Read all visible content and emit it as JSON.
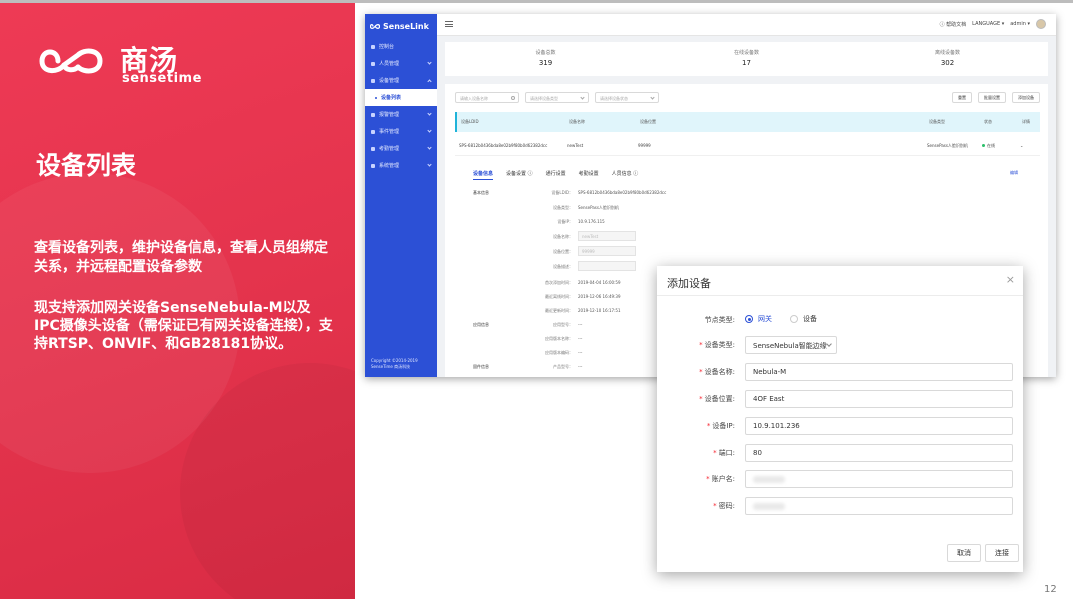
{
  "slide": {
    "logo_cn": "商汤",
    "logo_en": "sensetime",
    "title": "设备列表",
    "desc1": "查看设备列表，维护设备信息，查看人员组绑定关系，并远程配置设备参数",
    "desc2": "现支持添加网关设备SenseNebula-M以及IPC摄像头设备（需保证已有网关设备连接），支持RTSP、ONVIF、和GB28181协议。",
    "page_number": "12",
    "accent_color": "#e63550"
  },
  "app": {
    "brand": "SenseLink",
    "nav": [
      {
        "label": "控制台"
      },
      {
        "label": "人员管理"
      },
      {
        "label": "设备管理"
      },
      {
        "label": "设备列表"
      },
      {
        "label": "报警管理"
      },
      {
        "label": "事件管理"
      },
      {
        "label": "考勤管理"
      },
      {
        "label": "系统管理"
      }
    ],
    "copyright": "Copyright ©2014-2019 SenseTime 商汤科技",
    "topbar": {
      "help": "帮助文档",
      "language": "LANGUAGE ▾",
      "user": "admin ▾"
    },
    "stats": [
      {
        "label": "设备总数",
        "value": "319"
      },
      {
        "label": "在线设备数",
        "value": "17"
      },
      {
        "label": "离线设备数",
        "value": "302"
      }
    ],
    "filters": {
      "search_placeholder": "请输入设备名称",
      "type_placeholder": "请选择设备类型",
      "status_placeholder": "请选择设备状态"
    },
    "buttons": {
      "reset": "重置",
      "batch": "批量设置",
      "add": "添加设备"
    },
    "table": {
      "headers": [
        "设备LDID",
        "设备名称",
        "设备位置",
        "设备类型",
        "状态",
        "详情"
      ],
      "row": [
        "SPS-6812b0436bda8e02b9f80b0d62382dcc",
        "newTest",
        "99999",
        "SensePass人脸识别机",
        "在线",
        "⌄"
      ]
    },
    "tabs": [
      "设备信息",
      "设备设置 ⓘ",
      "通行设置",
      "考勤设置",
      "人员信息 ⓘ"
    ],
    "edit": "编辑",
    "detail": {
      "section_basic": "基本信息",
      "section_app": "应用信息",
      "section_fw": "固件信息",
      "rows": [
        {
          "label": "设备LDID：",
          "value": "SPS-6812b0436bda8e02b9f80b0d62382dcc"
        },
        {
          "label": "设备类型：",
          "value": "SensePass人脸识别机"
        },
        {
          "label": "设备IP：",
          "value": "10.9.176.115"
        },
        {
          "label": "设备名称：",
          "value": "newTest"
        },
        {
          "label": "设备位置：",
          "value": "99999"
        },
        {
          "label": "设备描述：",
          "value": ""
        },
        {
          "label": "首次添加时间：",
          "value": "2019-04-04 16:00:59"
        },
        {
          "label": "最近离线时间：",
          "value": "2019-12-06 16:49:39"
        },
        {
          "label": "最近更新时间：",
          "value": "2019-12-10 16:17:51"
        },
        {
          "label": "应用型号：",
          "value": "---"
        },
        {
          "label": "应用版本名称：",
          "value": "---"
        },
        {
          "label": "应用版本编码：",
          "value": "---"
        },
        {
          "label": "产品型号：",
          "value": "---"
        }
      ]
    }
  },
  "dialog": {
    "title": "添加设备",
    "close": "×",
    "node_type_label": "节点类型:",
    "radio_gateway": "网关",
    "radio_device": "设备",
    "fields": [
      {
        "label": "设备类型:",
        "value": "SenseNebula智能边缘"
      },
      {
        "label": "设备名称:",
        "value": "Nebula-M"
      },
      {
        "label": "设备位置:",
        "value": "4OF East"
      },
      {
        "label": "设备IP:",
        "value": "10.9.101.236"
      },
      {
        "label": "端口:",
        "value": "80"
      },
      {
        "label": "账户名:",
        "value": ""
      },
      {
        "label": "密码:",
        "value": ""
      }
    ],
    "cancel": "取消",
    "connect": "连接"
  }
}
